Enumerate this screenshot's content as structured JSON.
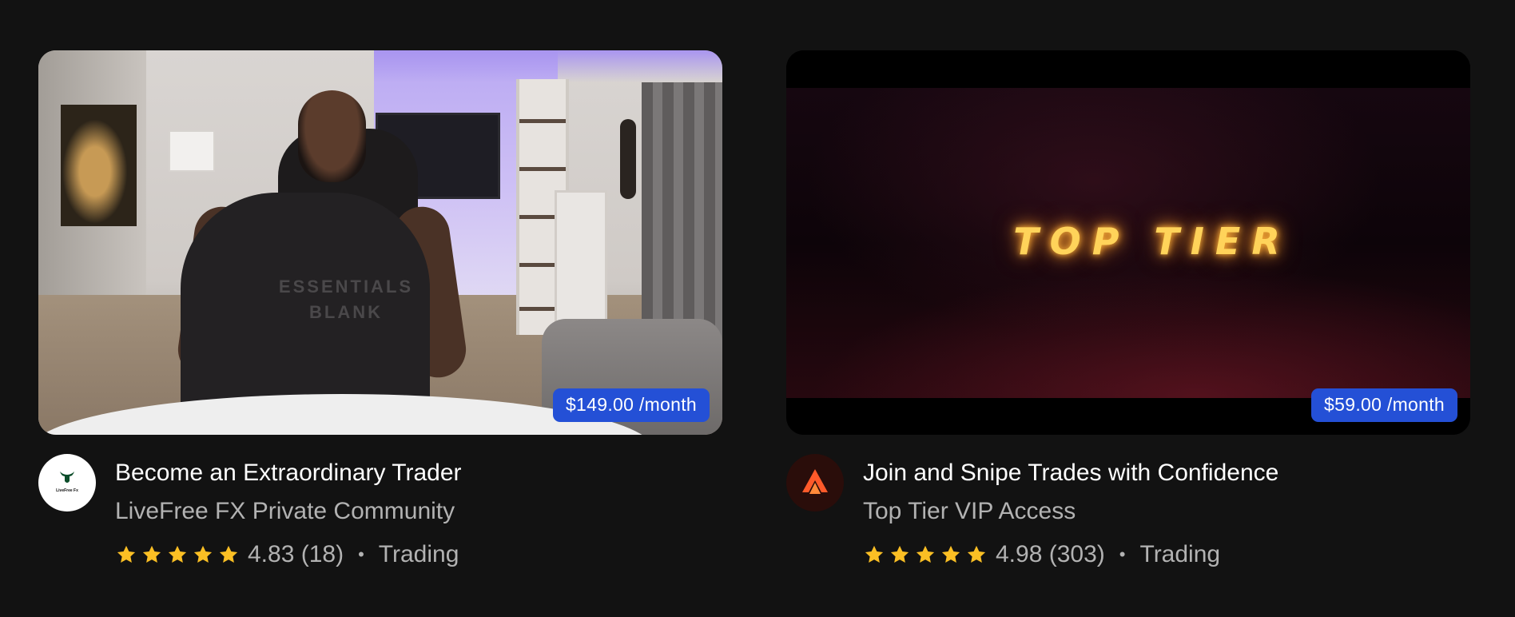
{
  "cards": [
    {
      "price": "$149.00 /month",
      "title": "Become an Extraordinary Trader",
      "community": "LiveFree FX Private Community",
      "rating": "4.83",
      "reviews": "(18)",
      "category": "Trading",
      "stars": 5,
      "avatar_text": "LiveFree Fx",
      "thumbnail_text": "ESSENTIALS BLANK"
    },
    {
      "price": "$59.00 /month",
      "title": "Join and Snipe Trades with Confidence",
      "community": "Top Tier VIP Access",
      "rating": "4.98",
      "reviews": "(303)",
      "category": "Trading",
      "stars": 5,
      "thumbnail_text": "TOP TIER"
    }
  ],
  "colors": {
    "background": "#121212",
    "price_badge": "#2450d6",
    "star": "#fbbf24",
    "secondary_text": "#b2b2b2"
  },
  "icons": {
    "star": "star-icon",
    "separator": "dot-separator"
  }
}
